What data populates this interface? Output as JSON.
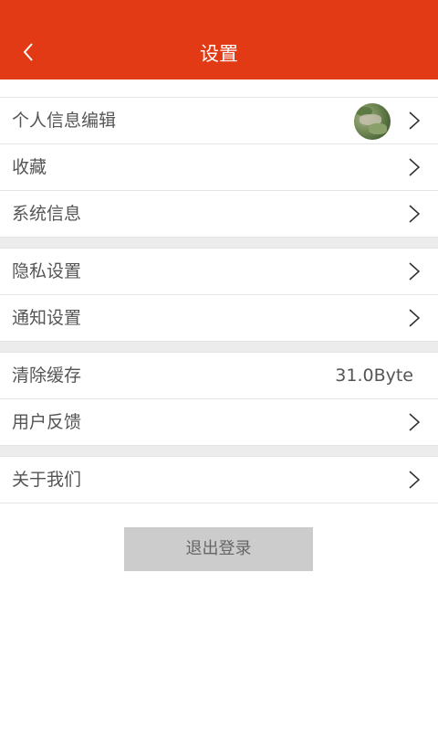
{
  "header": {
    "title": "设置",
    "back_icon": "chevron-left-icon",
    "bg_color": "#e33a16"
  },
  "groups": [
    {
      "items": [
        {
          "label": "个人信息编辑",
          "icon": "chevron-right-icon",
          "has_avatar": true
        },
        {
          "label": "收藏",
          "icon": "chevron-right-icon"
        },
        {
          "label": "系统信息",
          "icon": "chevron-right-icon"
        }
      ]
    },
    {
      "items": [
        {
          "label": "隐私设置",
          "icon": "chevron-right-icon"
        },
        {
          "label": "通知设置",
          "icon": "chevron-right-icon"
        }
      ]
    },
    {
      "items": [
        {
          "label": "清除缓存",
          "value": "31.0Byte"
        },
        {
          "label": "用户反馈",
          "icon": "chevron-right-icon"
        }
      ]
    },
    {
      "items": [
        {
          "label": "关于我们",
          "icon": "chevron-right-icon"
        }
      ]
    }
  ],
  "logout": {
    "label": "退出登录"
  }
}
